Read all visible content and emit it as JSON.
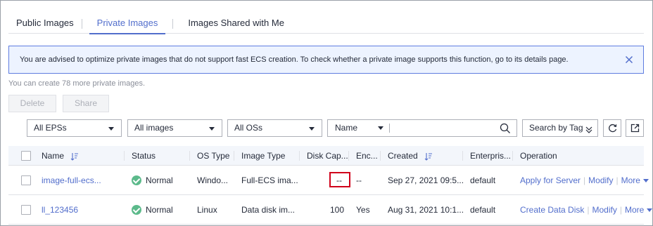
{
  "tabs": [
    {
      "label": "Public Images",
      "active": false
    },
    {
      "label": "Private Images",
      "active": true
    },
    {
      "label": "Images Shared with Me",
      "active": false
    }
  ],
  "alert": {
    "text": "You are advised to optimize private images that do not support fast ECS creation. To check whether a private image supports this function, go to its details page.",
    "close_icon": "close-icon"
  },
  "quota_text": "You can create 78 more private images.",
  "actions": {
    "delete_label": "Delete",
    "share_label": "Share"
  },
  "filters": {
    "eps": "All EPSs",
    "image_type": "All images",
    "os": "All OSs",
    "search_key": "Name",
    "search_value": "",
    "tag_search": "Search by Tag"
  },
  "table": {
    "headers": {
      "name": "Name",
      "status": "Status",
      "os_type": "OS Type",
      "image_type": "Image Type",
      "disk_capacity": "Disk Cap...",
      "encrypted": "Enc...",
      "created": "Created",
      "enterprise": "Enterpris...",
      "operation": "Operation"
    },
    "rows": [
      {
        "name": "image-full-ecs...",
        "status": "Normal",
        "os_type": "Windo...",
        "image_type": "Full-ECS ima...",
        "disk_capacity": "--",
        "encrypted": "--",
        "created": "Sep 27, 2021 09:5...",
        "enterprise": "default",
        "op_primary": "Apply for Server",
        "op_modify": "Modify",
        "op_more": "More"
      },
      {
        "name": "ll_123456",
        "status": "Normal",
        "os_type": "Linux",
        "image_type": "Data disk im...",
        "disk_capacity": "100",
        "encrypted": "Yes",
        "created": "Aug 31, 2021 10:1...",
        "enterprise": "default",
        "op_primary": "Create Data Disk",
        "op_modify": "Modify",
        "op_more": "More"
      }
    ]
  },
  "colors": {
    "accent": "#526ecc",
    "alert_bg": "#edf3ff",
    "alert_border": "#5e7ce0",
    "status_ok": "#5cba8b",
    "highlight": "#d0021b"
  }
}
